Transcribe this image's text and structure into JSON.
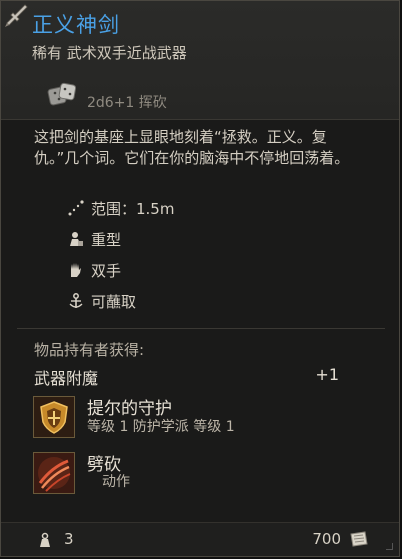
{
  "item": {
    "name": "正义神剑",
    "subtitle": "稀有 武术双手近战武器",
    "damage": "2d6+1 挥砍",
    "description": "这把剑的基座上显眼地刻着“拯救。正义。复仇。”几个词。它们在你的脑海中不停地回荡着。",
    "properties": [
      {
        "icon": "range-icon",
        "label": "范围：1.5m"
      },
      {
        "icon": "heavy-icon",
        "label": "重型"
      },
      {
        "icon": "two-handed-icon",
        "label": "双手"
      },
      {
        "icon": "dippable-icon",
        "label": "可蘸取"
      }
    ]
  },
  "holder": {
    "heading": "物品持有者获得:",
    "enchantment_label": "武器附魔",
    "enchantment_value": "+1",
    "spells": [
      {
        "name": "提尔的守护",
        "meta": "等级 1  防护学派  等级 1",
        "icon": "tyr-shield-icon"
      },
      {
        "name": "劈砍",
        "meta": "动作",
        "icon": "cleave-icon"
      }
    ]
  },
  "footer": {
    "weight": "3",
    "price": "700"
  },
  "colors": {
    "title": "#4aa1e6",
    "background": "#1a1a19"
  }
}
